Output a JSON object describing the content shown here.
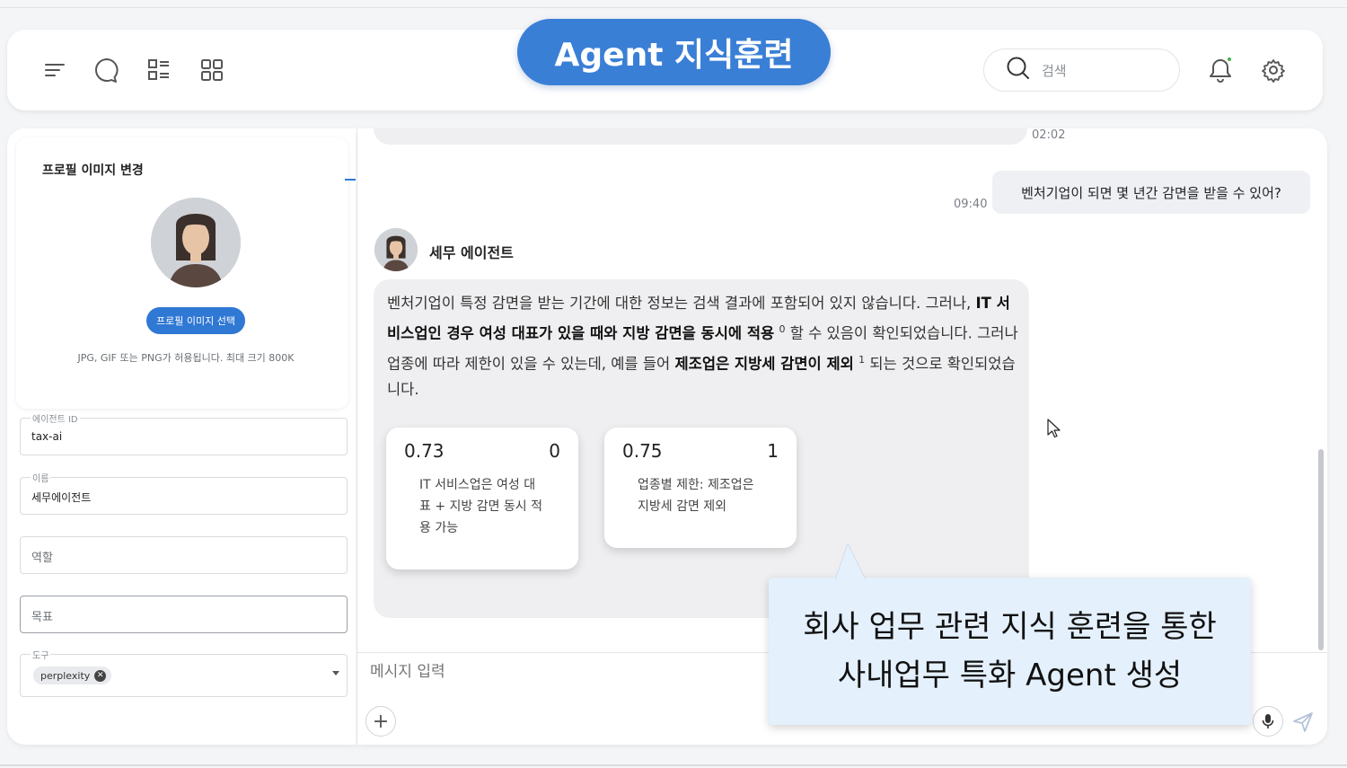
{
  "header": {
    "title": "Agent 지식훈련",
    "search_placeholder": "검색"
  },
  "profile": {
    "title": "프로필 이미지 변경",
    "select_button": "프로필 이미지 선택",
    "hint": "JPG, GIF 또는 PNG가 허용됩니다. 최대 크기 800K"
  },
  "form": {
    "agent_id_label": "에이전트 ID",
    "agent_id_value": "tax-ai",
    "name_label": "이름",
    "name_value": "세무에이전트",
    "role_placeholder": "역할",
    "goal_placeholder": "목표",
    "tools_label": "도구",
    "tools": [
      "perplexity"
    ]
  },
  "chat": {
    "time_top": "02:02",
    "user_message": "벤처기업이 되면 몇 년간 감면을 받을 수 있어?",
    "user_time": "09:40",
    "agent_name": "세무 에이전트",
    "agent_text": {
      "p1": "벤처기업이 특정 감면을 받는 기간에 대한 정보는 검색 결과에 포함되어 있지 않습니다. 그러나, ",
      "b1": "IT 서비스업인 경우 여성 대표가 있을 때와 지방 감면을 동시에 적용",
      "sup1": "0",
      "p2": " 할 수 있음이 확인되었습니다. 그러나 업종에 따라 제한이 있을 수 있는데, 예를 들어 ",
      "b2": "제조업은 지방세 감면이 제외",
      "sup2": "1",
      "p3": " 되는 것으로 확인되었습니다."
    },
    "sources": [
      {
        "score": "0.73",
        "index": "0",
        "desc": "IT 서비스업은 여성 대표 + 지방 감면 동시 적용 가능"
      },
      {
        "score": "0.75",
        "index": "1",
        "desc": "업종별 제한: 제조업은 지방세 감면 제외"
      }
    ],
    "input_placeholder": "메시지 입력"
  },
  "callout": {
    "line1": "회사 업무 관련 지식 훈련을 통한",
    "line2": "사내업무 특화 Agent 생성"
  },
  "colors": {
    "accent": "#3a7fd6",
    "callout_bg": "#e4f0fb"
  }
}
